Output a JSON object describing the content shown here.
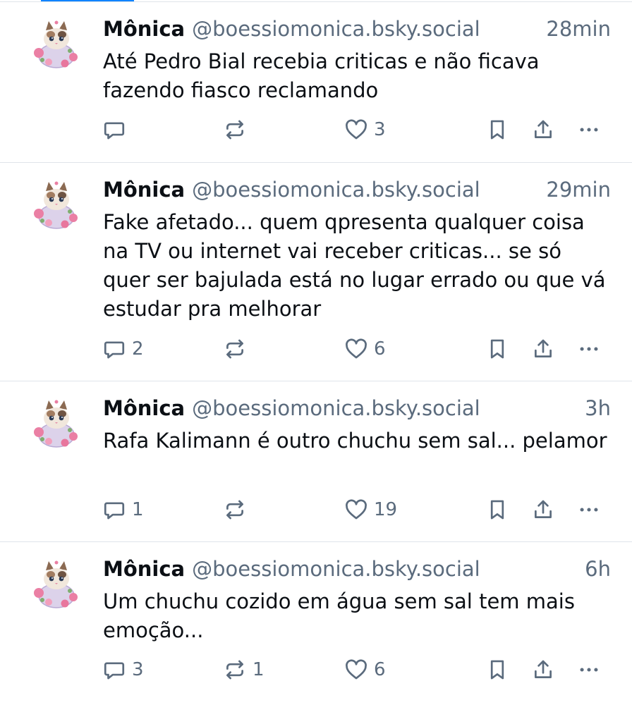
{
  "posts": [
    {
      "display_name": "Mônica",
      "handle": "@boessiomonica.bsky.social",
      "time": "28min",
      "text": "Até Pedro Bial recebia criticas e não ficava fazendo fiasco reclamando",
      "replies": "",
      "reposts": "",
      "likes": "3"
    },
    {
      "display_name": "Mônica",
      "handle": "@boessiomonica.bsky.social",
      "time": "29min",
      "text": "Fake afetado... quem qpresenta qualquer coisa na TV ou internet vai receber criticas... se só quer ser bajulada está no lugar errado ou que vá estudar pra melhorar",
      "replies": "2",
      "reposts": "",
      "likes": "6"
    },
    {
      "display_name": "Mônica",
      "handle": "@boessiomonica.bsky.social",
      "time": "3h",
      "text": "Rafa Kalimann é outro chuchu sem sal... pelamor",
      "replies": "1",
      "reposts": "",
      "likes": "19"
    },
    {
      "display_name": "Mônica",
      "handle": "@boessiomonica.bsky.social",
      "time": "6h",
      "text": "Um chuchu cozido em água sem sal tem mais emoção...",
      "replies": "3",
      "reposts": "1",
      "likes": "6"
    }
  ],
  "icons": {
    "reply": "reply-icon",
    "repost": "repost-icon",
    "like": "heart-icon",
    "bookmark": "bookmark-icon",
    "share": "share-icon",
    "more": "more-icon"
  },
  "colors": {
    "text": "#0b0f14",
    "muted": "#5b6b7d",
    "divider": "#dfe4ea",
    "accent": "#1083fe"
  }
}
